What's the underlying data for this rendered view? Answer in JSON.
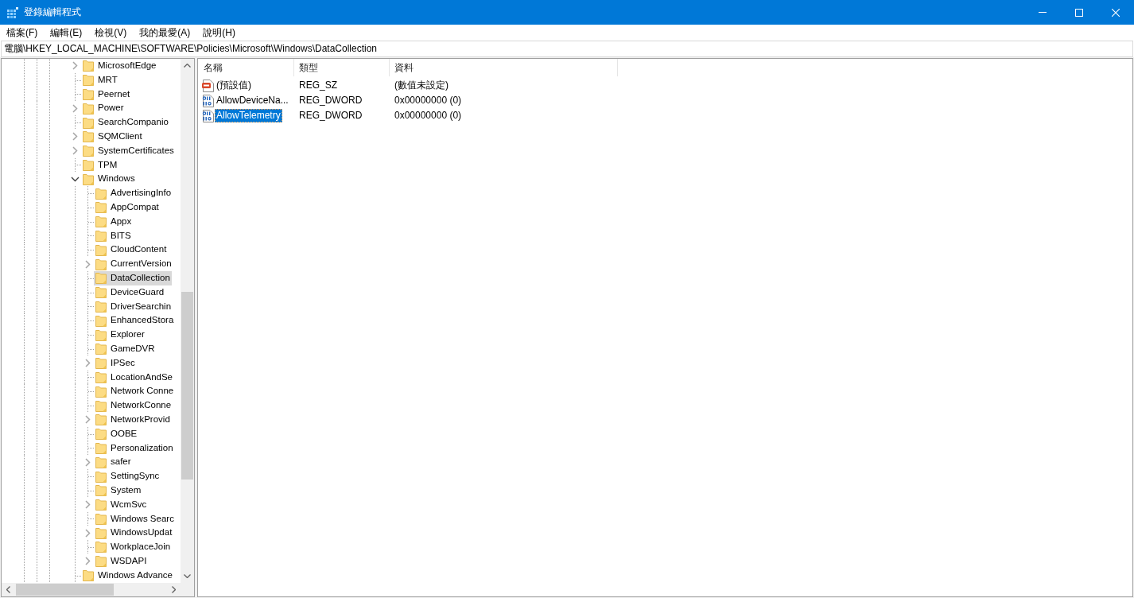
{
  "window": {
    "title": "登錄編輯程式"
  },
  "menu": [
    {
      "label": "檔案(F)"
    },
    {
      "label": "編輯(E)"
    },
    {
      "label": "檢視(V)"
    },
    {
      "label": "我的最愛(A)"
    },
    {
      "label": "說明(H)"
    }
  ],
  "address_bar": {
    "value": "電腦\\HKEY_LOCAL_MACHINE\\SOFTWARE\\Policies\\Microsoft\\Windows\\DataCollection"
  },
  "tree": {
    "items": [
      {
        "label": "MicrosoftEdge",
        "expanded": false,
        "selected": false
      },
      {
        "label": "MRT",
        "selected": false
      },
      {
        "label": "Peernet",
        "selected": false
      },
      {
        "label": "Power",
        "expanded": false,
        "selected": false
      },
      {
        "label": "SearchCompanio",
        "selected": false
      },
      {
        "label": "SQMClient",
        "expanded": false,
        "selected": false
      },
      {
        "label": "SystemCertificates",
        "expanded": false,
        "selected": false
      },
      {
        "label": "TPM",
        "selected": false
      },
      {
        "label": "Windows",
        "expanded": true,
        "selected": false,
        "children": [
          {
            "label": "AdvertisingInfo",
            "selected": false
          },
          {
            "label": "AppCompat",
            "selected": false
          },
          {
            "label": "Appx",
            "selected": false
          },
          {
            "label": "BITS",
            "selected": false
          },
          {
            "label": "CloudContent",
            "selected": false
          },
          {
            "label": "CurrentVersion",
            "expanded": false,
            "selected": false
          },
          {
            "label": "DataCollection",
            "selected": true
          },
          {
            "label": "DeviceGuard",
            "selected": false
          },
          {
            "label": "DriverSearchin",
            "selected": false
          },
          {
            "label": "EnhancedStora",
            "selected": false
          },
          {
            "label": "Explorer",
            "selected": false
          },
          {
            "label": "GameDVR",
            "selected": false
          },
          {
            "label": "IPSec",
            "expanded": false,
            "selected": false
          },
          {
            "label": "LocationAndSe",
            "selected": false
          },
          {
            "label": "Network Conne",
            "selected": false
          },
          {
            "label": "NetworkConne",
            "selected": false
          },
          {
            "label": "NetworkProvid",
            "expanded": false,
            "selected": false
          },
          {
            "label": "OOBE",
            "selected": false
          },
          {
            "label": "Personalization",
            "selected": false
          },
          {
            "label": "safer",
            "expanded": false,
            "selected": false
          },
          {
            "label": "SettingSync",
            "selected": false
          },
          {
            "label": "System",
            "selected": false
          },
          {
            "label": "WcmSvc",
            "expanded": false,
            "selected": false
          },
          {
            "label": "Windows Searc",
            "selected": false
          },
          {
            "label": "WindowsUpdat",
            "expanded": false,
            "selected": false
          },
          {
            "label": "WorkplaceJoin",
            "selected": false
          },
          {
            "label": "WSDAPI",
            "expanded": false,
            "selected": false
          }
        ]
      },
      {
        "label": "Windows Advance",
        "selected": false
      }
    ]
  },
  "values_list": {
    "columns": [
      "名稱",
      "類型",
      "資料"
    ],
    "rows": [
      {
        "kind": "string",
        "name": "(預設值)",
        "type": "REG_SZ",
        "data": "(數值未設定)",
        "selected": false
      },
      {
        "kind": "dword",
        "name": "AllowDeviceNa...",
        "type": "REG_DWORD",
        "data": "0x00000000 (0)",
        "selected": false
      },
      {
        "kind": "dword",
        "name": "AllowTelemetry",
        "type": "REG_DWORD",
        "data": "0x00000000 (0)",
        "selected": true
      }
    ]
  }
}
